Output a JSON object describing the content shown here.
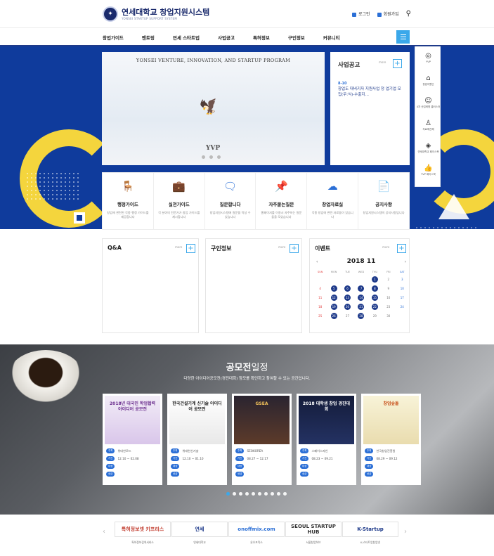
{
  "header": {
    "logo_title": "연세대학교 창업지원시스템",
    "logo_sub": "YONSEI STARTUP SUPPORT SYSTEM",
    "login": "로그인",
    "join": "회원가입"
  },
  "nav": [
    "창업가이드",
    "멘토링",
    "연세 스타트업",
    "사업공고",
    "특허정보",
    "구인정보",
    "커뮤니티"
  ],
  "hero": {
    "caption": "YONSEI VENTURE, INNOVATION, AND STARTUP PROGRAM",
    "mark": "YVP"
  },
  "notice": {
    "title": "사업공고",
    "more": "more",
    "date": "8-10",
    "text": "창업도 대비키자 지원사업 정 업기업 모집(우:식)-수출지…"
  },
  "quick": [
    {
      "icon": "yvp-icon",
      "label": "YVP"
    },
    {
      "icon": "building-icon",
      "label": "창업지원단"
    },
    {
      "icon": "head-icon",
      "label": "4차 산업혁명 클러스터"
    },
    {
      "icon": "ribbon-icon",
      "label": "자료에관해"
    },
    {
      "icon": "shield-icon",
      "label": "연세대학교 페이스북"
    },
    {
      "icon": "thumb-icon",
      "label": "YVP 페이스북"
    }
  ],
  "services": [
    {
      "title": "행정가이드",
      "desc": "창업에 관련된 각종 행정 가이드를 제공합니다",
      "icon": "chair-icon"
    },
    {
      "title": "실전가이드",
      "desc": "각 분야의 전문가가 창업 가이드를 제시합니다",
      "icon": "briefcase-icon"
    },
    {
      "title": "질문합니다",
      "desc": "창업지원시스템에 질문을 작성 수 있습니다",
      "icon": "chat-icon"
    },
    {
      "title": "자주묻는질문",
      "desc": "홈페이지를 이용시 자주하는 질문들을 모았습니다",
      "icon": "pin-icon"
    },
    {
      "title": "창업자료실",
      "desc": "각종 창업에 관련 자료들이 있습니다",
      "icon": "cloud-icon"
    },
    {
      "title": "공지사항",
      "desc": "창업지원시스템의 공지사항입니다",
      "icon": "document-icon"
    }
  ],
  "boards": {
    "qa": "Q&A",
    "jobs": "구인정보",
    "events": "이벤트",
    "more": "more"
  },
  "calendar": {
    "title": "2018 11",
    "weekdays": [
      "SUN",
      "MON",
      "TUE",
      "WED",
      "THU",
      "FRI",
      "SAT"
    ],
    "weeks": [
      [
        "",
        "",
        "",
        "",
        "1",
        "2",
        "3"
      ],
      [
        "4",
        "5",
        "6",
        "7",
        "8",
        "9",
        "10"
      ],
      [
        "11",
        "12",
        "13",
        "14",
        "15",
        "16",
        "17"
      ],
      [
        "18",
        "19",
        "20",
        "21",
        "22",
        "23",
        "24"
      ],
      [
        "25",
        "26",
        "27",
        "28",
        "29",
        "30",
        ""
      ]
    ],
    "event_days": [
      "1",
      "5",
      "6",
      "7",
      "8",
      "12",
      "13",
      "14",
      "15",
      "19",
      "20",
      "21",
      "22",
      "26",
      "28"
    ]
  },
  "contest": {
    "title_bold": "공모전",
    "title_light": "일정",
    "subtitle": "다양한 아이디어공모전(경진대회) 참모를 확인하고 참여할 수 있는 공간입니다.",
    "cards": [
      {
        "host": "위대한로드",
        "period": "12.10 ~ 02.08",
        "poster": "2018년 대국민 학업협력 아이디어 공모전"
      },
      {
        "host": "위대한신기술",
        "period": "12.10 ~ 01.10",
        "poster": "한국건설기계 신기술 아이디어 공모전"
      },
      {
        "host": "SEOKOREA",
        "period": "08.27 ~ 12.17",
        "poster": "GSEA"
      },
      {
        "host": "스페이스자인",
        "period": "08.23 ~ 09.21",
        "poster": "2018 대학생 창업 경진대회"
      },
      {
        "host": "한국창업진흥원",
        "period": "08.29 ~ 09.12",
        "poster": "창업숲돌"
      }
    ],
    "labels": {
      "host": "주최",
      "period": "기간",
      "target": "대상",
      "prize": "상금"
    }
  },
  "partners": [
    {
      "logo": "특허정보넷 키프리스",
      "name": "특허정보검색서비스"
    },
    {
      "logo": "연세",
      "name": "연세대학교"
    },
    {
      "logo": "onoffmix.com",
      "name": "온오프믹스"
    },
    {
      "logo": "SEOUL STARTUP HUB",
      "name": "서울창업허브"
    },
    {
      "logo": "K-Startup",
      "name": "K-스타트업창업넷"
    }
  ],
  "colors": {
    "brand": "#1e3a8a",
    "accent": "#3ba8ea",
    "yellow": "#f4d53d"
  }
}
